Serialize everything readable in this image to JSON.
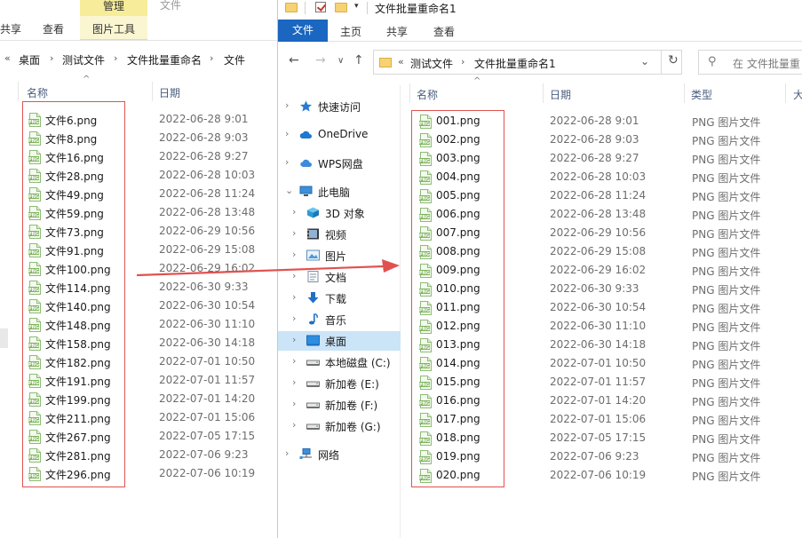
{
  "left": {
    "ribbon": {
      "manage_tab": "管理",
      "file_tab_ghost": "文件",
      "share_tab": "共享",
      "view_tab": "查看",
      "picture_tools_tab": "图片工具"
    },
    "address": {
      "overflow": "«",
      "crumbs": [
        "桌面",
        "测试文件",
        "文件批量重命名",
        "文件"
      ]
    },
    "columns": {
      "name": "名称",
      "date": "日期"
    },
    "files": [
      {
        "name": "文件6.png",
        "date": "2022-06-28 9:01"
      },
      {
        "name": "文件8.png",
        "date": "2022-06-28 9:03"
      },
      {
        "name": "文件16.png",
        "date": "2022-06-28 9:27"
      },
      {
        "name": "文件28.png",
        "date": "2022-06-28 10:03"
      },
      {
        "name": "文件49.png",
        "date": "2022-06-28 11:24"
      },
      {
        "name": "文件59.png",
        "date": "2022-06-28 13:48"
      },
      {
        "name": "文件73.png",
        "date": "2022-06-29 10:56"
      },
      {
        "name": "文件91.png",
        "date": "2022-06-29 15:08"
      },
      {
        "name": "文件100.png",
        "date": "2022-06-29 16:02"
      },
      {
        "name": "文件114.png",
        "date": "2022-06-30 9:33"
      },
      {
        "name": "文件140.png",
        "date": "2022-06-30 10:54"
      },
      {
        "name": "文件148.png",
        "date": "2022-06-30 11:10"
      },
      {
        "name": "文件158.png",
        "date": "2022-06-30 14:18"
      },
      {
        "name": "文件182.png",
        "date": "2022-07-01 10:50"
      },
      {
        "name": "文件191.png",
        "date": "2022-07-01 11:57"
      },
      {
        "name": "文件199.png",
        "date": "2022-07-01 14:20"
      },
      {
        "name": "文件211.png",
        "date": "2022-07-01 15:06"
      },
      {
        "name": "文件267.png",
        "date": "2022-07-05 17:15"
      },
      {
        "name": "文件281.png",
        "date": "2022-07-06 9:23"
      },
      {
        "name": "文件296.png",
        "date": "2022-07-06 10:19"
      }
    ]
  },
  "right": {
    "title": "文件批量重命名1",
    "ribbon": {
      "file_tab": "文件",
      "home_tab": "主页",
      "share_tab": "共享",
      "view_tab": "查看"
    },
    "address": {
      "overflow": "«",
      "crumbs": [
        "测试文件",
        "文件批量重命名1"
      ]
    },
    "search": {
      "placeholder": "在 文件批量重"
    },
    "nav_pane": [
      {
        "label": "快速访问",
        "icon": "star-icon"
      },
      {
        "label": "OneDrive",
        "icon": "cloud-icon"
      },
      {
        "label": "WPS网盘",
        "icon": "wps-cloud-icon"
      },
      {
        "label": "此电脑",
        "icon": "computer-icon"
      },
      {
        "label": "3D 对象",
        "icon": "cube-icon"
      },
      {
        "label": "视频",
        "icon": "video-icon"
      },
      {
        "label": "图片",
        "icon": "picture-icon"
      },
      {
        "label": "文档",
        "icon": "document-icon"
      },
      {
        "label": "下载",
        "icon": "download-icon"
      },
      {
        "label": "音乐",
        "icon": "music-icon"
      },
      {
        "label": "桌面",
        "icon": "desktop-icon"
      },
      {
        "label": "本地磁盘 (C:)",
        "icon": "drive-icon"
      },
      {
        "label": "新加卷 (E:)",
        "icon": "drive-icon"
      },
      {
        "label": "新加卷 (F:)",
        "icon": "drive-icon"
      },
      {
        "label": "新加卷 (G:)",
        "icon": "drive-icon"
      },
      {
        "label": "网络",
        "icon": "network-icon"
      }
    ],
    "columns": {
      "name": "名称",
      "date": "日期",
      "type": "类型",
      "size_partial": "大"
    },
    "files": [
      {
        "name": "001.png",
        "date": "2022-06-28 9:01",
        "type": "PNG 图片文件"
      },
      {
        "name": "002.png",
        "date": "2022-06-28 9:03",
        "type": "PNG 图片文件"
      },
      {
        "name": "003.png",
        "date": "2022-06-28 9:27",
        "type": "PNG 图片文件"
      },
      {
        "name": "004.png",
        "date": "2022-06-28 10:03",
        "type": "PNG 图片文件"
      },
      {
        "name": "005.png",
        "date": "2022-06-28 11:24",
        "type": "PNG 图片文件"
      },
      {
        "name": "006.png",
        "date": "2022-06-28 13:48",
        "type": "PNG 图片文件"
      },
      {
        "name": "007.png",
        "date": "2022-06-29 10:56",
        "type": "PNG 图片文件"
      },
      {
        "name": "008.png",
        "date": "2022-06-29 15:08",
        "type": "PNG 图片文件"
      },
      {
        "name": "009.png",
        "date": "2022-06-29 16:02",
        "type": "PNG 图片文件"
      },
      {
        "name": "010.png",
        "date": "2022-06-30 9:33",
        "type": "PNG 图片文件"
      },
      {
        "name": "011.png",
        "date": "2022-06-30 10:54",
        "type": "PNG 图片文件"
      },
      {
        "name": "012.png",
        "date": "2022-06-30 11:10",
        "type": "PNG 图片文件"
      },
      {
        "name": "013.png",
        "date": "2022-06-30 14:18",
        "type": "PNG 图片文件"
      },
      {
        "name": "014.png",
        "date": "2022-07-01 10:50",
        "type": "PNG 图片文件"
      },
      {
        "name": "015.png",
        "date": "2022-07-01 11:57",
        "type": "PNG 图片文件"
      },
      {
        "name": "016.png",
        "date": "2022-07-01 14:20",
        "type": "PNG 图片文件"
      },
      {
        "name": "017.png",
        "date": "2022-07-01 15:06",
        "type": "PNG 图片文件"
      },
      {
        "name": "018.png",
        "date": "2022-07-05 17:15",
        "type": "PNG 图片文件"
      },
      {
        "name": "019.png",
        "date": "2022-07-06 9:23",
        "type": "PNG 图片文件"
      },
      {
        "name": "020.png",
        "date": "2022-07-06 10:19",
        "type": "PNG 图片文件"
      }
    ]
  },
  "colors": {
    "file_tab_blue": "#1a66c0",
    "manage_tab_yellow": "#f6ec9a",
    "annotation_red": "#e0524f",
    "selected_nav": "#cce4f7"
  }
}
